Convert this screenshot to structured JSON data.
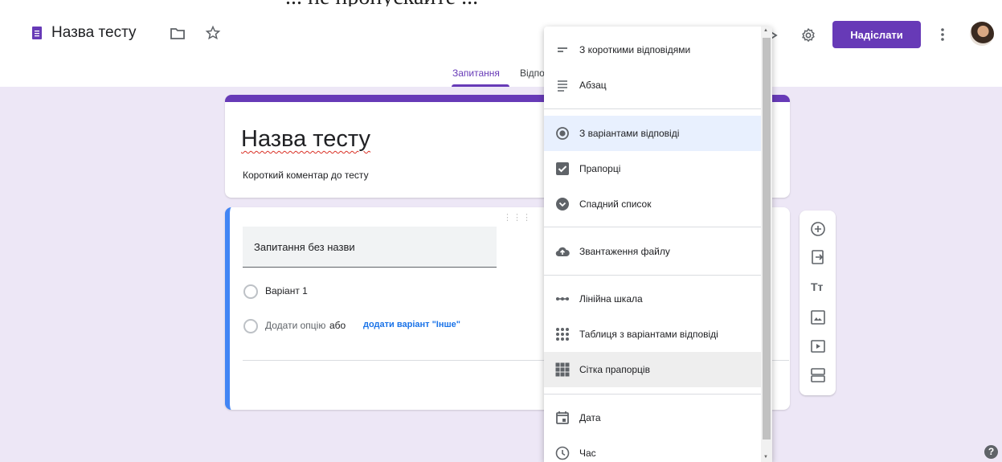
{
  "top_clip": {
    "text": "... не пропускайте ..."
  },
  "header": {
    "title": "Назва тесту",
    "send_label": "Надіслати"
  },
  "tabs": [
    {
      "label": "Запитання"
    },
    {
      "label": "Відповіді"
    }
  ],
  "form": {
    "title": "Назва тесту",
    "description": "Короткий коментар до тесту"
  },
  "question": {
    "title": "Запитання без назви",
    "option1": "Варіант 1",
    "add_option": "Додати опцію",
    "or_word": "або",
    "add_other": "додати варіант \"Інше\""
  },
  "type_menu": {
    "items": [
      {
        "label": "З короткими відповідями",
        "icon": "short-answer-icon"
      },
      {
        "label": "Абзац",
        "icon": "paragraph-icon"
      },
      {
        "label": "З варіантами відповіді",
        "icon": "radio-button-icon",
        "selected": true
      },
      {
        "label": "Прапорці",
        "icon": "checkbox-icon"
      },
      {
        "label": "Спадний список",
        "icon": "dropdown-icon"
      },
      {
        "label": "Звантаження файлу",
        "icon": "cloud-upload-icon"
      },
      {
        "label": "Лінійна шкала",
        "icon": "linear-scale-icon"
      },
      {
        "label": "Таблиця з варіантами відповіді",
        "icon": "grid-multiple-choice-icon"
      },
      {
        "label": "Сітка прапорців",
        "icon": "checkbox-grid-icon",
        "hovered": true
      },
      {
        "label": "Дата",
        "icon": "calendar-icon"
      },
      {
        "label": "Час",
        "icon": "clock-icon"
      }
    ]
  },
  "colors": {
    "accent": "#673ab7",
    "link": "#1a73e8",
    "question_border": "#4285f4",
    "background": "#ede7f6"
  }
}
